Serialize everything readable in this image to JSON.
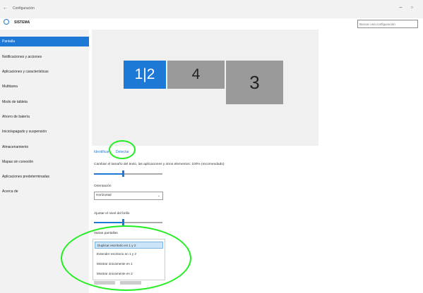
{
  "window": {
    "back_glyph": "←",
    "title": "Configuración",
    "min_glyph": "−",
    "max_glyph": "□"
  },
  "header": {
    "section_title": "SISTEMA",
    "search_placeholder": "Buscar una configuración"
  },
  "sidebar": {
    "items": [
      {
        "label": "Pantalla",
        "active": true
      },
      {
        "label": "Notificaciones y acciones"
      },
      {
        "label": "Aplicaciones y características"
      },
      {
        "label": "Multitarea"
      },
      {
        "label": "Modo de tableta"
      },
      {
        "label": "Ahorro de batería"
      },
      {
        "label": "Inicio/apagado y suspensión"
      },
      {
        "label": "Almacenamiento"
      },
      {
        "label": "Mapas sin conexión"
      },
      {
        "label": "Aplicaciones predeterminadas"
      },
      {
        "label": "Acerca de"
      }
    ]
  },
  "displays": [
    {
      "label": "1|2",
      "selected": true
    },
    {
      "label": "4"
    },
    {
      "label": "3"
    }
  ],
  "links": {
    "identify": "Identificar",
    "detect": "Detectar"
  },
  "scale": {
    "label": "Cambiar el tamaño del texto, las aplicaciones y otros elementos: 100% (recomendado)",
    "level": 0.42
  },
  "orientation": {
    "label": "Orientación",
    "value": "Horizontal",
    "chevron": "⌄"
  },
  "brightness": {
    "label": "Ajustar el nivel del brillo",
    "level": 0.42
  },
  "multiple_displays": {
    "label": "Varias pantallas",
    "options": [
      {
        "label": "Duplicar escritorio en 1 y 2",
        "selected": true
      },
      {
        "label": "Extender escritorio en 1 y 2"
      },
      {
        "label": "Mostrar únicamente en 1"
      },
      {
        "label": "Mostrar únicamente en 2"
      }
    ]
  },
  "colors": {
    "accent": "#1e78d6",
    "highlight_circle": "#22ee22",
    "sidebar_bg": "#f2f2f2"
  }
}
